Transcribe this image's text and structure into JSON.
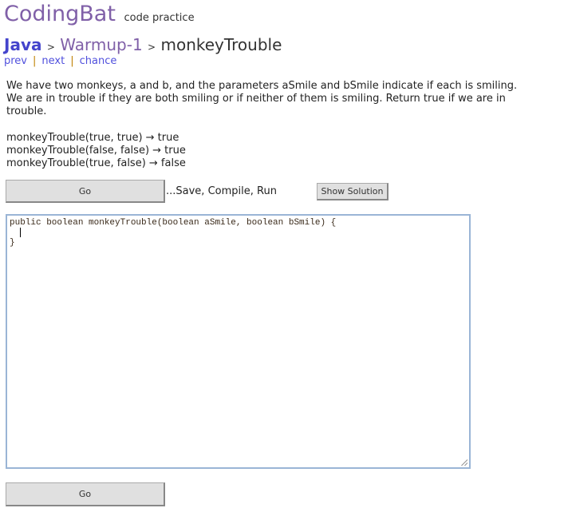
{
  "site": {
    "logo": "CodingBat",
    "tagline": "code practice"
  },
  "breadcrumb": {
    "lang": "Java",
    "sep": ">",
    "section": "Warmup-1",
    "problem": "monkeyTrouble"
  },
  "nav": {
    "prev": "prev",
    "next": "next",
    "chance": "chance",
    "sep": "|"
  },
  "description": "We have two monkeys, a and b, and the parameters aSmile and bSmile indicate if each is smiling. We are in trouble if they are both smiling or if neither of them is smiling. Return true if we are in trouble.",
  "examples": [
    "monkeyTrouble(true, true) → true",
    "monkeyTrouble(false, false) → true",
    "monkeyTrouble(true, false) → false"
  ],
  "toolbar": {
    "go_label": "Go",
    "save_text": "...Save, Compile, Run",
    "solution_label": "Show Solution"
  },
  "editor": {
    "line1": "public boolean monkeyTrouble(boolean aSmile, boolean bSmile) {",
    "line2": "  ",
    "line3": "}"
  }
}
